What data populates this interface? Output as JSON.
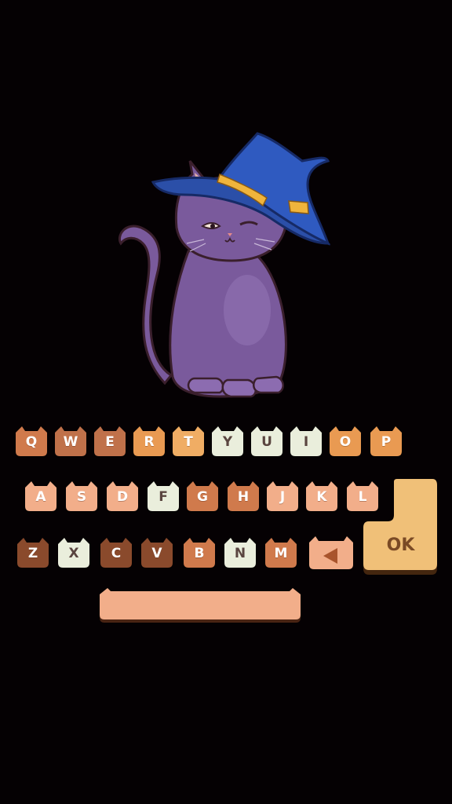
{
  "illustration": {
    "name": "witch-hat-cat",
    "colors": {
      "cat_body": "#7a5a9c",
      "hat": "#2b4fa8",
      "hat_band": "#f0b43c"
    }
  },
  "keyboard": {
    "row1": [
      {
        "label": "Q",
        "color": "#d07a4c"
      },
      {
        "label": "W",
        "color": "#c0714a"
      },
      {
        "label": "E",
        "color": "#c0714a"
      },
      {
        "label": "R",
        "color": "#e99a52"
      },
      {
        "label": "T",
        "color": "#f0ad64"
      },
      {
        "label": "Y",
        "color": "#eaeedc"
      },
      {
        "label": "U",
        "color": "#eaeedc"
      },
      {
        "label": "I",
        "color": "#eaeedc"
      },
      {
        "label": "O",
        "color": "#e99a52"
      },
      {
        "label": "P",
        "color": "#e99a52"
      }
    ],
    "row2": [
      {
        "label": "A",
        "color": "#f2ae8a"
      },
      {
        "label": "S",
        "color": "#f2ae8a"
      },
      {
        "label": "D",
        "color": "#f2ae8a"
      },
      {
        "label": "F",
        "color": "#eaeedc"
      },
      {
        "label": "G",
        "color": "#d07a4c"
      },
      {
        "label": "H",
        "color": "#d07a4c"
      },
      {
        "label": "J",
        "color": "#f2ae8a"
      },
      {
        "label": "K",
        "color": "#f2ae8a"
      },
      {
        "label": "L",
        "color": "#f2ae8a"
      }
    ],
    "row3": [
      {
        "label": "Z",
        "color": "#8a4a2c"
      },
      {
        "label": "X",
        "color": "#eaeedc"
      },
      {
        "label": "C",
        "color": "#8a4a2c"
      },
      {
        "label": "V",
        "color": "#8a4a2c"
      },
      {
        "label": "B",
        "color": "#d07a4c"
      },
      {
        "label": "N",
        "color": "#eaeedc"
      },
      {
        "label": "M",
        "color": "#d07a4c"
      }
    ],
    "backspace": {
      "icon": "backspace-triangle-icon",
      "color": "#f2ae8a",
      "glyph_color": "#a8542c"
    },
    "ok": {
      "label": "OK",
      "color": "#f0c078"
    },
    "space": {
      "color": "#f2ae8a"
    }
  }
}
